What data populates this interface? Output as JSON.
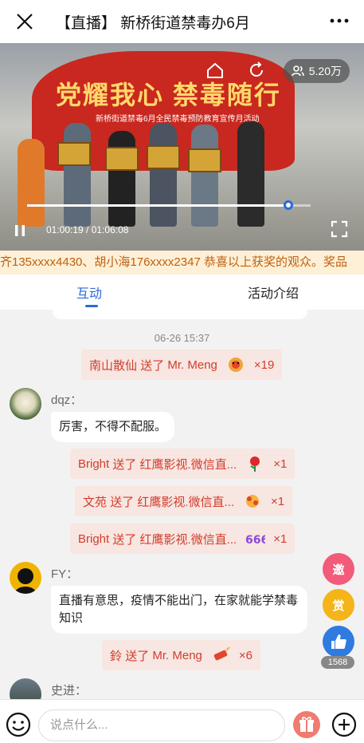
{
  "header": {
    "title": "【直播】 新桥街道禁毒办6月"
  },
  "video": {
    "banner_title": "党耀我心 禁毒随行",
    "banner_sub": "新桥街道禁毒6月全民禁毒预防教育宣传月活动",
    "viewers": "5.20万",
    "time": "01:00:19 / 01:06:08",
    "progress_fraction": 0.92
  },
  "ticker": {
    "text": "齐135xxxx4430、胡小海176xxxx2347 恭喜以上获奖的观众。奖品"
  },
  "tabs": {
    "interact": "互动",
    "intro": "活动介绍"
  },
  "feed": {
    "timestamp": "06-26 15:37",
    "gift1": {
      "sender": "南山散仙",
      "verb": "送了",
      "target": "Mr. Meng",
      "count": "×19"
    },
    "user1": {
      "name": "dqz：",
      "msg": "厉害，不得不配服。"
    },
    "gift2": {
      "sender": "Bright",
      "verb": "送了",
      "target": "红鹰影视.微信直...",
      "count": "×1"
    },
    "gift3": {
      "sender": "文苑",
      "verb": "送了",
      "target": "红鹰影视.微信直...",
      "count": "×1"
    },
    "gift4": {
      "sender": "Bright",
      "verb": "送了",
      "target": "红鹰影视.微信直...",
      "count": "×1"
    },
    "user2": {
      "name": "FY：",
      "msg": "直播有意思，疫情不能出门，在家就能学禁毒知识"
    },
    "gift5": {
      "sender": "鈴",
      "verb": "送了",
      "target": "Mr. Meng",
      "count": "×6"
    },
    "user3": {
      "name": "史进："
    }
  },
  "side": {
    "invite": "邀",
    "reward": "赏",
    "likes": "1568"
  },
  "bottom": {
    "placeholder": "说点什么..."
  },
  "colors": {
    "accent": "#2a6ad8",
    "gift_text": "#d33c2c",
    "gift_bg": "#f7e6e1"
  }
}
